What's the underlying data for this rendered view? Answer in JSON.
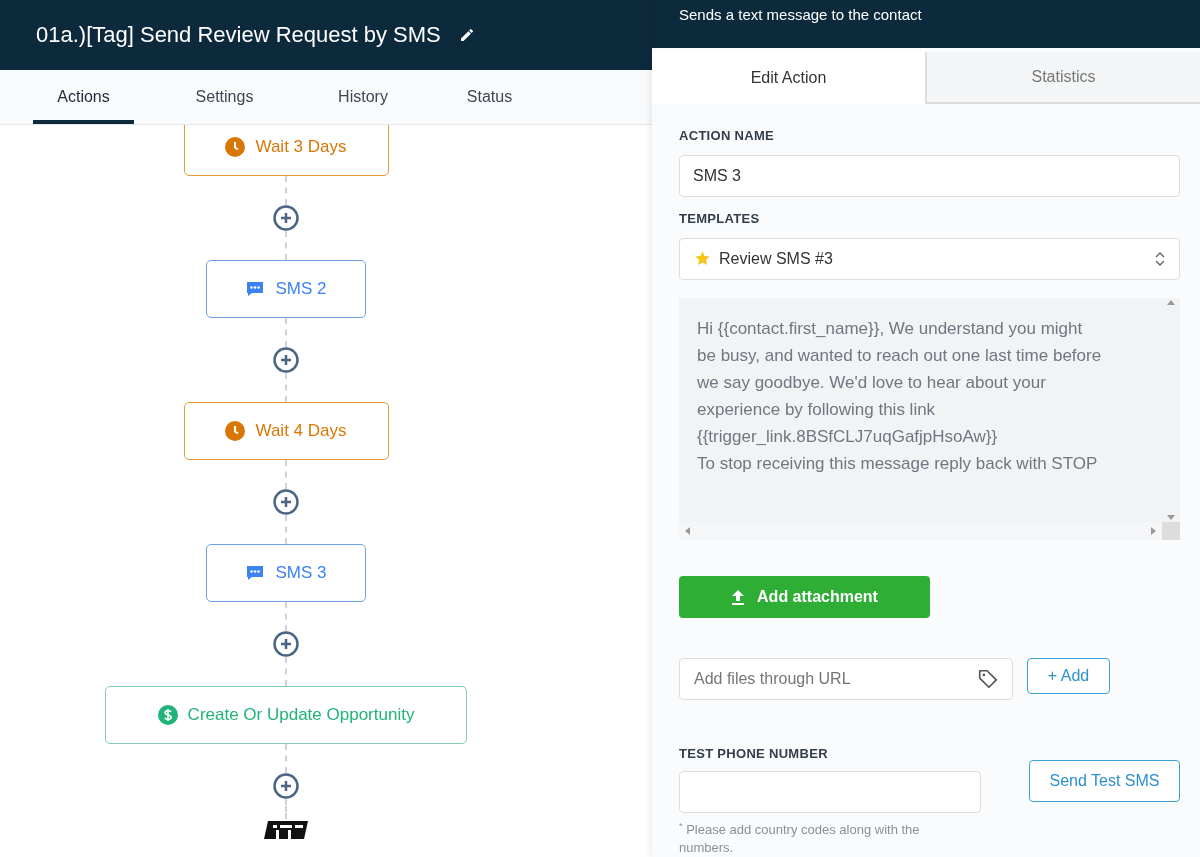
{
  "header": {
    "title": "01a.)[Tag] Send Review Request by SMS"
  },
  "tabs": [
    {
      "label": "Actions",
      "selected": true
    },
    {
      "label": "Settings",
      "selected": false
    },
    {
      "label": "History",
      "selected": false
    },
    {
      "label": "Status",
      "selected": false
    }
  ],
  "workflow": {
    "nodes": [
      {
        "kind": "wait",
        "label": "Wait 3 Days"
      },
      {
        "kind": "sms",
        "label": "SMS 2"
      },
      {
        "kind": "wait",
        "label": "Wait 4 Days"
      },
      {
        "kind": "sms",
        "label": "SMS 3"
      },
      {
        "kind": "opportunity",
        "label": "Create Or Update Opportunity"
      },
      {
        "kind": "end"
      }
    ]
  },
  "panel": {
    "subtitle": "Sends a text message to the contact",
    "tabs": [
      {
        "label": "Edit Action",
        "selected": true
      },
      {
        "label": "Statistics",
        "selected": false
      }
    ],
    "action_name": {
      "label": "ACTION NAME",
      "value": "SMS 3"
    },
    "templates": {
      "label": "TEMPLATES",
      "value": "Review SMS #3"
    },
    "message": "Hi {{contact.first_name}}, We understand you might be busy, and wanted to reach out one last time before we say goodbye. We'd love to hear about your experience by following this link\n{{trigger_link.8BSfCLJ7uqGafjpHsoAw}}\nTo stop receiving this message reply back with STOP",
    "attachment_button": "Add attachment",
    "url_field": {
      "placeholder": "Add files through URL"
    },
    "add_button": "+ Add",
    "test_phone": {
      "label": "TEST PHONE NUMBER",
      "note_mark": "*",
      "note": "Please add country codes along with the numbers."
    },
    "send_test_button": "Send Test SMS"
  }
}
